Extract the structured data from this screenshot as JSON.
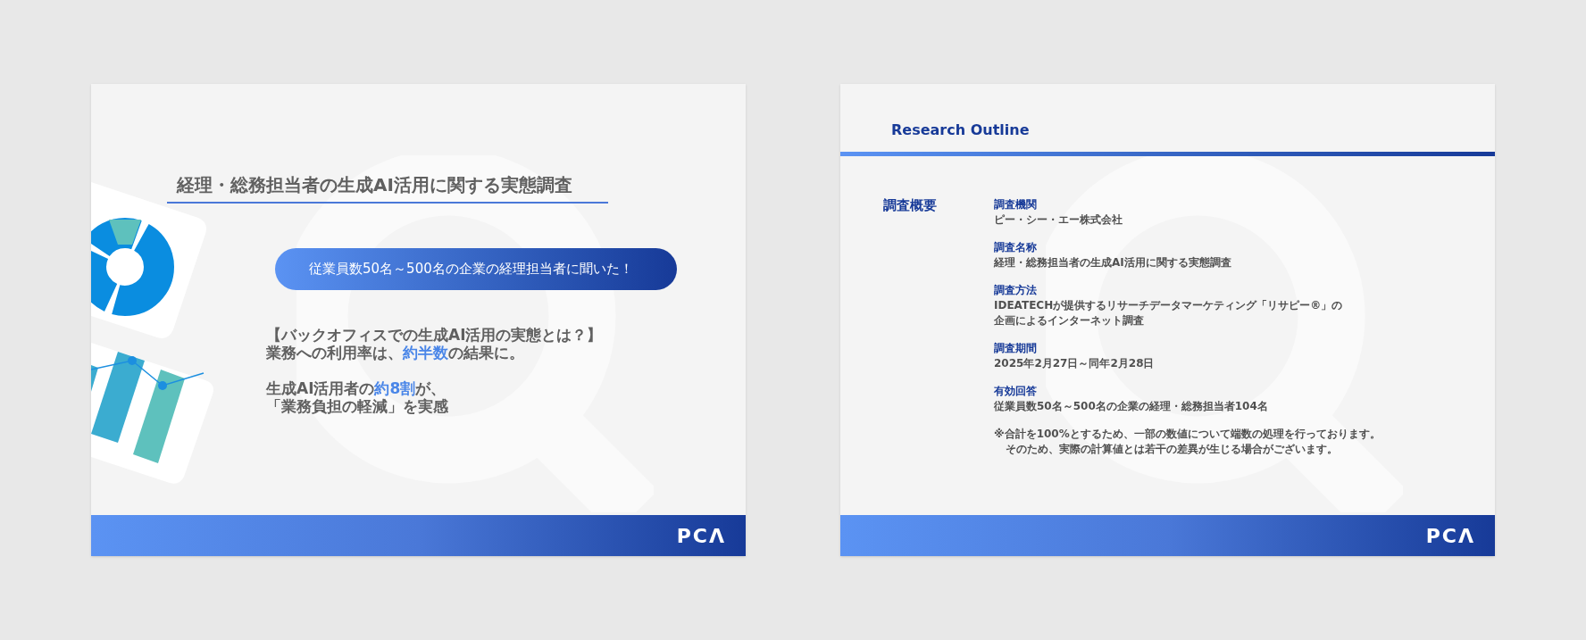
{
  "slides": [
    {
      "kind": "cover",
      "title": "経理・総務担当者の生成AI活用に関する実態調査",
      "pill": "従業員数50名～500名の企業の経理担当者に聞いた！",
      "paragraphs": [
        [
          "【バックオフィスでの生成AI活用の実態とは？】",
          "業務への利用率は、**約半数**の結果に。"
        ],
        [
          "生成AI活用者の**約8割**が、",
          "「業務負担の軽減」を実感"
        ]
      ],
      "logo": "PCΛ"
    },
    {
      "kind": "outline",
      "heading": "Research Outline",
      "section_label": "調査概要",
      "items": [
        {
          "label": "調査機関",
          "lines": [
            "ピー・シー・エー株式会社"
          ]
        },
        {
          "label": "調査名称",
          "lines": [
            "経理・総務担当者の生成AI活用に関する実態調査"
          ]
        },
        {
          "label": "調査方法",
          "lines": [
            "IDEATECHが提供するリサーチデータマーケティング「リサピー®」の",
            "企画によるインターネット調査"
          ]
        },
        {
          "label": "調査期間",
          "lines": [
            "2025年2月27日～同年2月28日"
          ]
        },
        {
          "label": "有効回答",
          "lines": [
            "従業員数50名～500名の企業の経理・総務担当者104名"
          ]
        }
      ],
      "note_lines": [
        "※合計を100%とするため、一部の数値について端数の処理を行っております。",
        "そのため、実際の計算値とは若干の差異が生じる場合がございます。"
      ],
      "logo": "PCΛ"
    }
  ]
}
